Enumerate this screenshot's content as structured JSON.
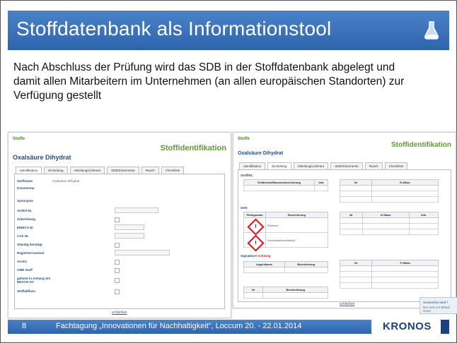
{
  "slide": {
    "title": "Stoffdatenbank als Informationstool",
    "lead": "Nach Abschluss der Prüfung wird das SDB in der Stoffdatenbank abgelegt und damit allen Mitarbeitern im Unternehmen (an allen europäischen Standorten) zur Verfügung gestellt",
    "page_number": "8",
    "footer": "Fachtagung „Innovationen für Nachhaltigkeit“, Loccum  20. - 22.01.2014",
    "logo": "KRONOS",
    "icon": "flask-icon"
  },
  "left_shot": {
    "crumb": "Stoffe",
    "heading": "Stoffidentifikation",
    "substance": "Oxalsäure Dihydrat",
    "tabs": [
      "Identifikation",
      "Einstufung",
      "Abteilung/Lieferant",
      "SDB/Dokumente",
      "Reach",
      "Checkliste"
    ],
    "fields": [
      {
        "label": "Stoffname",
        "value": "Oxalsäure Dihydrat"
      },
      {
        "label": "Kommentar",
        "value": ""
      },
      {
        "label": "Synonyme",
        "value": ""
      },
      {
        "label": "Artikel Nr.",
        "value": ""
      },
      {
        "label": "Zubereitung",
        "value": ""
      },
      {
        "label": "EINECS Nr.",
        "value": ""
      },
      {
        "label": "CAS Nr.",
        "value": ""
      },
      {
        "label": "Ständig benötigt",
        "value": ""
      },
      {
        "label": "Registriernummer",
        "value": ""
      },
      {
        "label": "Archiv",
        "value": ""
      },
      {
        "label": "CMR Stoff",
        "value": ""
      },
      {
        "label": "gelistet in Anhang XIV REACH VO",
        "value": ""
      },
      {
        "label": "Stoffabfluss",
        "value": ""
      }
    ],
    "link": "schließen"
  },
  "right_shot": {
    "crumb": "Stoffe",
    "heading": "Stoffidentifikation",
    "substance": "Oxalsäure Dihydrat",
    "tabs": [
      "Identifikation",
      "Einstufung",
      "Abteilung/Lieferant",
      "SDB/Dokumente",
      "Reach",
      "Checkliste"
    ],
    "sections": {
      "first": "Stoff/RL",
      "first_cols": [
        "Gefahrstoffklassenbezeichnung",
        "Info"
      ],
      "first_cols2": [
        "Nr",
        "R-Sätze"
      ],
      "ghs_title": "GHS",
      "ghs_cols": [
        "Piktogramm",
        "Bezeichnung"
      ],
      "ghs_cols2": [
        "Nr",
        "H-Sätze",
        "Info"
      ],
      "ghs_rows": [
        "Reizend",
        "Gesundheitsschädlich"
      ],
      "signal_label": "Signalwort",
      "signal_word": "Achtung",
      "lager_cols": [
        "Lagerklasse",
        "Bezeichnung"
      ],
      "p_cols": [
        "Nr",
        "P-Sätze"
      ],
      "wgk_cols": [
        "Nr",
        "Beschreibung"
      ]
    },
    "link": "schließen"
  },
  "overlay": {
    "line1": "Screenshot wird f",
    "line2": "Der Link zur Brand Gone"
  }
}
